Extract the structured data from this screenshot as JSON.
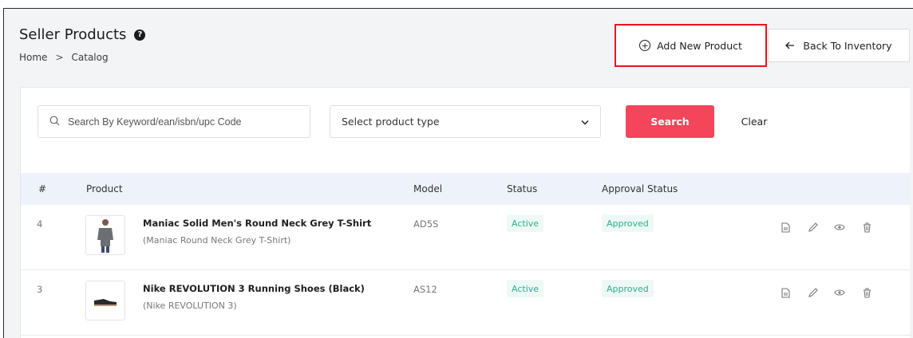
{
  "header": {
    "title": "Seller Products",
    "help_icon": "?",
    "breadcrumb": [
      "Home",
      "Catalog"
    ],
    "breadcrumb_sep": ">"
  },
  "actions": {
    "add_label": "Add New Product",
    "back_label": "Back To Inventory"
  },
  "filters": {
    "search_placeholder": "Search By Keyword/ean/isbn/upc Code",
    "search_value": "",
    "select_label": "Select product type",
    "search_button": "Search",
    "clear_button": "Clear"
  },
  "table": {
    "columns": [
      "#",
      "Product",
      "Model",
      "Status",
      "Approval Status"
    ],
    "rows": [
      {
        "num": "4",
        "name": "Maniac Solid Men's Round Neck Grey T-Shirt",
        "sub": "(Maniac Round Neck Grey T-Shirt)",
        "model": "AD5S",
        "status": "Active",
        "approval": "Approved",
        "thumb": "tshirt-image"
      },
      {
        "num": "3",
        "name": "Nike REVOLUTION 3 Running Shoes (Black)",
        "sub": "(Nike REVOLUTION 3)",
        "model": "AS12",
        "status": "Active",
        "approval": "Approved",
        "thumb": "shoe-image"
      }
    ]
  },
  "colors": {
    "accent": "#f4455a",
    "highlight_border": "#e8141d",
    "status_green": "#2bb089",
    "header_bg": "#eef2fb"
  }
}
